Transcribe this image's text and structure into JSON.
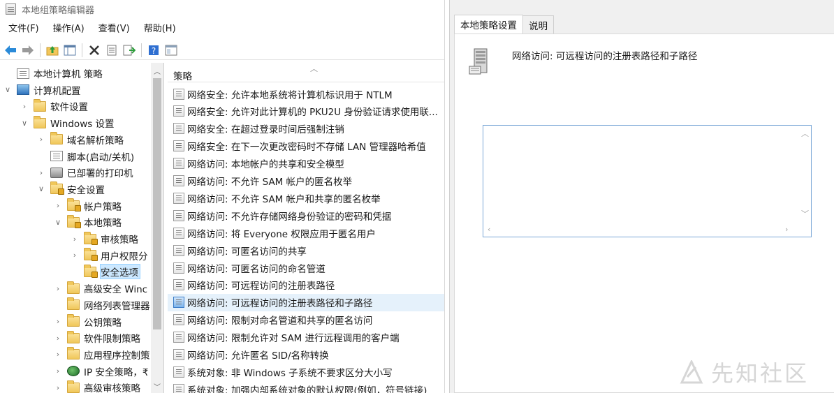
{
  "window": {
    "title": "本地组策略编辑器"
  },
  "menu": [
    "文件(F)",
    "操作(A)",
    "查看(V)",
    "帮助(H)"
  ],
  "toolbar_icons": [
    "back-icon",
    "forward-icon",
    "up-folder-icon",
    "show-hide-tree-icon",
    "delete-icon",
    "properties-icon",
    "export-icon",
    "help-icon",
    "view-icon"
  ],
  "tree": [
    {
      "label": "本地计算机 策略",
      "exp": "",
      "icon": "doc"
    },
    {
      "label": "计算机配置",
      "exp": "∨",
      "icon": "comp"
    },
    {
      "label": "软件设置",
      "exp": "›",
      "icon": "folder"
    },
    {
      "label": "Windows 设置",
      "exp": "∨",
      "icon": "folder"
    },
    {
      "label": "域名解析策略",
      "exp": "›",
      "icon": "folder"
    },
    {
      "label": "脚本(启动/关机)",
      "exp": "",
      "icon": "doc"
    },
    {
      "label": "已部署的打印机",
      "exp": "›",
      "icon": "printer"
    },
    {
      "label": "安全设置",
      "exp": "∨",
      "icon": "lockfolder"
    },
    {
      "label": "帐户策略",
      "exp": "›",
      "icon": "lockfolder"
    },
    {
      "label": "本地策略",
      "exp": "∨",
      "icon": "lockfolder"
    },
    {
      "label": "审核策略",
      "exp": "›",
      "icon": "lockfolder"
    },
    {
      "label": "用户权限分",
      "exp": "›",
      "icon": "lockfolder"
    },
    {
      "label": "安全选项",
      "exp": "",
      "icon": "lockfolder"
    },
    {
      "label": "高级安全 Winc",
      "exp": "›",
      "icon": "folder"
    },
    {
      "label": "网络列表管理器",
      "exp": "",
      "icon": "folder"
    },
    {
      "label": "公钥策略",
      "exp": "›",
      "icon": "folder"
    },
    {
      "label": "软件限制策略",
      "exp": "›",
      "icon": "folder"
    },
    {
      "label": "应用程序控制策",
      "exp": "›",
      "icon": "folder"
    },
    {
      "label": "IP 安全策略，₹",
      "exp": "›",
      "icon": "ip"
    },
    {
      "label": "高级审核策略",
      "exp": "›",
      "icon": "folder"
    }
  ],
  "list": {
    "header": "策略",
    "rows": [
      "网络安全: 允许本地系统将计算机标识用于 NTLM",
      "网络安全: 允许对此计算机的 PKU2U 身份验证请求使用联...",
      "网络安全: 在超过登录时间后强制注销",
      "网络安全: 在下一次更改密码时不存储 LAN 管理器哈希值",
      "网络访问: 本地帐户的共享和安全模型",
      "网络访问: 不允许 SAM 帐户的匿名枚举",
      "网络访问: 不允许 SAM 帐户和共享的匿名枚举",
      "网络访问: 不允许存储网络身份验证的密码和凭据",
      "网络访问: 将 Everyone 权限应用于匿名用户",
      "网络访问: 可匿名访问的共享",
      "网络访问: 可匿名访问的命名管道",
      "网络访问: 可远程访问的注册表路径",
      "网络访问: 可远程访问的注册表路径和子路径",
      "网络访问: 限制对命名管道和共享的匿名访问",
      "网络访问: 限制允许对 SAM 进行远程调用的客户端",
      "网络访问: 允许匿名 SID/名称转换",
      "系统对象: 非 Windows 子系统不要求区分大小写",
      "系统对象: 加强内部系统对象的默认权限(例如，符号链接)"
    ]
  },
  "dialog": {
    "tabs": [
      "本地策略设置",
      "说明"
    ],
    "policy_name": "网络访问: 可远程访问的注册表路径和子路径",
    "setting_value": ""
  },
  "watermark": "先知社区"
}
